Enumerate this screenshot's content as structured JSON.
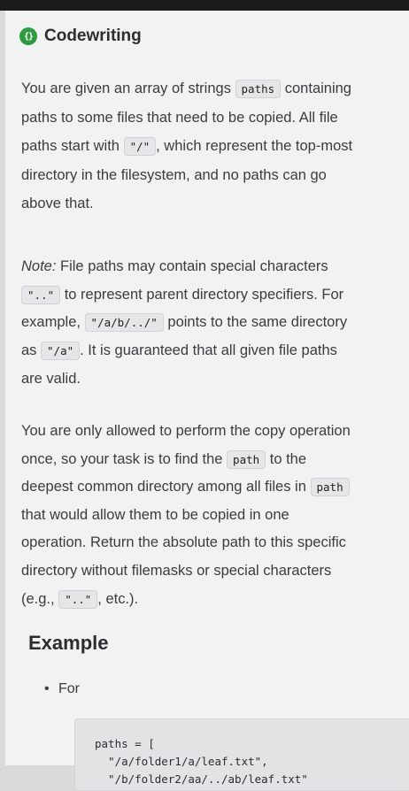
{
  "header": {
    "title": "Codewriting",
    "icon": "braces-icon"
  },
  "paragraph1": {
    "l1a": "You are given an array of strings ",
    "l1code": "paths",
    "l1b": " containing",
    "l2": "paths to some files that need to be copied. All file",
    "l3a": "paths start with ",
    "l3code": "\"/\"",
    "l3b": ", which represent the top-most",
    "l4": "directory in the filesystem, and no paths can go",
    "l5": "above that."
  },
  "paragraph2": {
    "note": "Note:",
    "l1": " File paths may contain special characters",
    "l2code": "\"..\"",
    "l2": " to represent parent directory specifiers. For",
    "l3a": "example, ",
    "l3code": "\"/a/b/../\"",
    "l3b": " points to the same directory",
    "l4a": "as ",
    "l4code": "\"/a\"",
    "l4b": ". It is guaranteed that all given file paths",
    "l5": "are valid."
  },
  "paragraph3": {
    "l1": "You are only allowed to perform the copy operation",
    "l2a": "once, so your task is to find the ",
    "l2code": "path",
    "l2b": " to the",
    "l3a": "deepest common directory among all files in ",
    "l3code": "path",
    "l4": "that would allow them to be copied in one",
    "l5": "operation. Return the absolute path to this specific",
    "l6": "directory without filemasks or special characters",
    "l7a": "(e.g., ",
    "l7code": "\"..\"",
    "l7b": ", etc.)."
  },
  "example": {
    "title": "Example",
    "bullet": "For",
    "code": [
      "paths = [",
      "  \"/a/folder1/a/leaf.txt\",",
      "  \"/b/folder2/aa/../ab/leaf.txt\""
    ]
  }
}
